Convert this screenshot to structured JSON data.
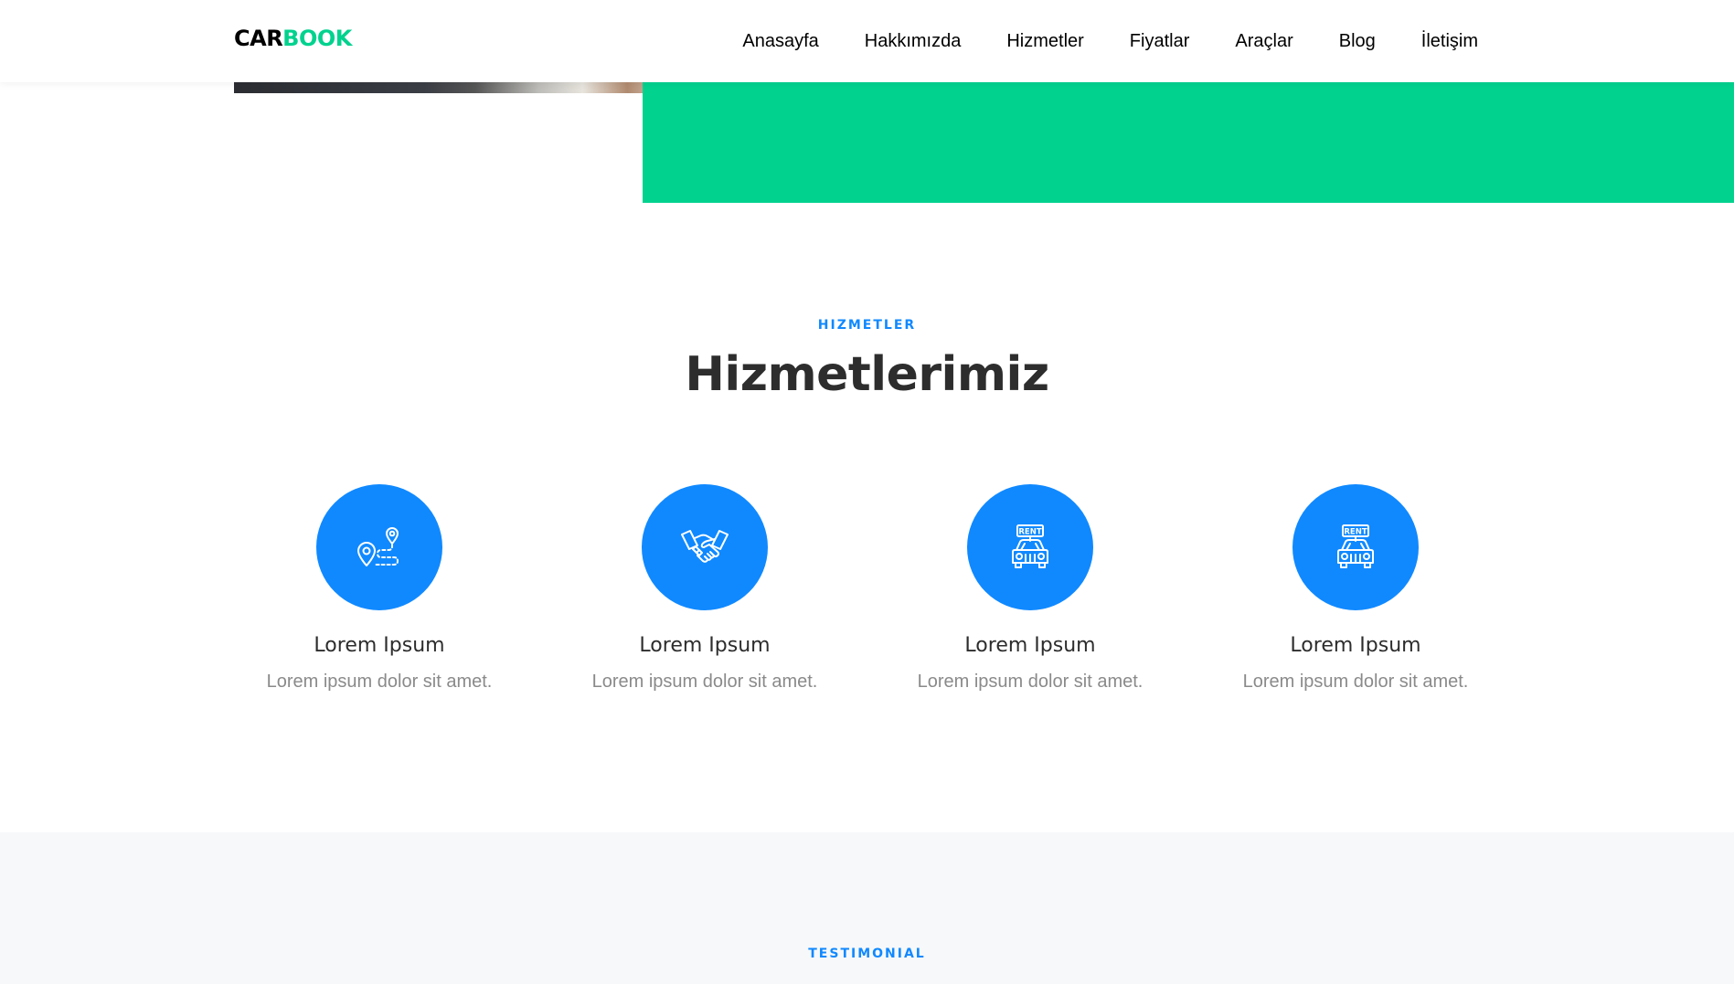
{
  "brand": {
    "logo_part1": "CAR",
    "logo_part2": "BOOK"
  },
  "nav": {
    "items": [
      {
        "label": "Anasayfa"
      },
      {
        "label": "Hakkımızda"
      },
      {
        "label": "Hizmetler"
      },
      {
        "label": "Fiyatlar"
      },
      {
        "label": "Araçlar"
      },
      {
        "label": "Blog"
      },
      {
        "label": "İletişim"
      }
    ]
  },
  "services": {
    "subheading": "HIZMETLER",
    "heading": "Hizmetlerimiz",
    "items": [
      {
        "icon": "route-map-icon",
        "title": "Lorem Ipsum",
        "text": "Lorem ipsum dolor sit amet."
      },
      {
        "icon": "handshake-icon",
        "title": "Lorem Ipsum",
        "text": "Lorem ipsum dolor sit amet."
      },
      {
        "icon": "rent-car-icon",
        "title": "Lorem Ipsum",
        "text": "Lorem ipsum dolor sit amet."
      },
      {
        "icon": "rent-car-icon",
        "title": "Lorem Ipsum",
        "text": "Lorem ipsum dolor sit amet."
      }
    ]
  },
  "testimonial": {
    "subheading": "TESTIMONIAL"
  },
  "colors": {
    "primary": "#1089ff",
    "brand_green": "#01d28e",
    "heading": "#2d2d2d",
    "muted": "#8a8a8a",
    "light_bg": "#f7f8fa"
  }
}
